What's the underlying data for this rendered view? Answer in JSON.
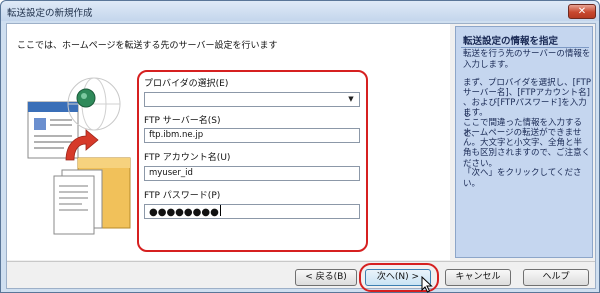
{
  "window": {
    "title": "転送設定の新規作成",
    "close_label": "✕"
  },
  "main": {
    "intro": "ここでは、ホームページを転送する先のサーバー設定を行います"
  },
  "form": {
    "provider_label": "プロバイダの選択(E)",
    "provider_value": "",
    "server_label": "FTP サーバー名(S)",
    "server_value": "ftp.ibm.ne.jp",
    "account_label": "FTP アカウント名(U)",
    "account_value": "myuser_id",
    "password_label": "FTP パスワード(P)",
    "password_value": "●●●●●●●●"
  },
  "help": {
    "title": "転送設定の情報を指定",
    "line1": "転送を行う先のサーバーの情報を",
    "line2": "入力します。",
    "para2_lines": [
      "まず、プロバイダを選択し、[FTP",
      "サーバー名]、[FTPアカウント名]",
      "、および[FTPパスワード]を入力し",
      "ます。",
      "ここで間違った情報を入力すると、",
      "ホームページの転送ができませ",
      "ん。大文字と小文字、全角と半",
      "角も区別されますので、ご注意ください。"
    ],
    "para3": "「次へ」をクリックしてください。"
  },
  "buttons": {
    "back": "< 戻る(B)",
    "next": "次へ(N) >",
    "cancel": "キャンセル",
    "help": "ヘルプ"
  },
  "colors": {
    "accent_red": "#d62020",
    "help_panel_bg": "#c5d6ef",
    "window_frame": "#cfdff0"
  }
}
